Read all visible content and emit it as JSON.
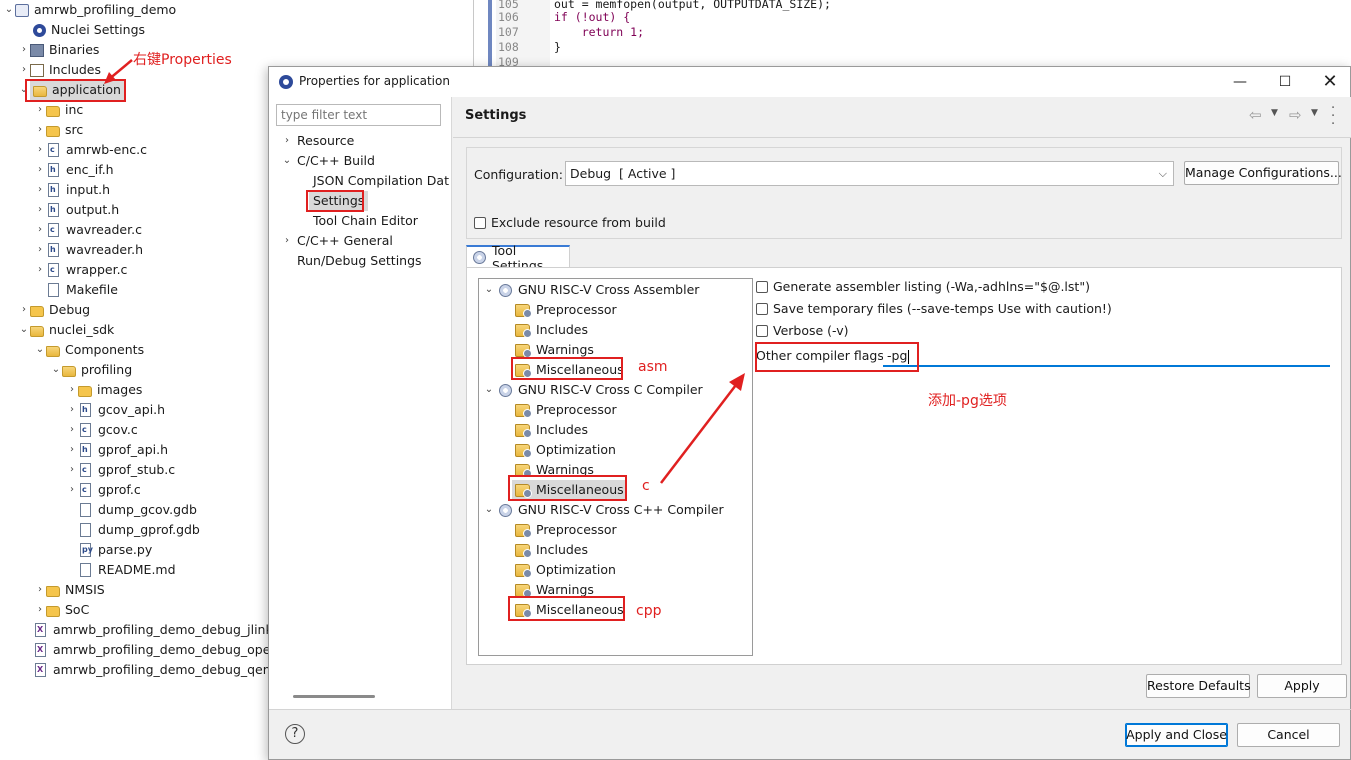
{
  "code": {
    "lines": [
      {
        "num": "105",
        "text": "out = memfopen(output, OUTPUTDATA_SIZE);"
      },
      {
        "num": "106",
        "text": "if (!out) {"
      },
      {
        "num": "107",
        "text": "    return 1;"
      },
      {
        "num": "108",
        "text": "}"
      },
      {
        "num": "109",
        "text": ""
      }
    ]
  },
  "explorer": {
    "project": "amrwb_profiling_demo",
    "nuclei_settings": "Nuclei Settings",
    "binaries": "Binaries",
    "includes": "Includes",
    "application": "application",
    "app_children": [
      "inc",
      "src",
      "amrwb-enc.c",
      "enc_if.h",
      "input.h",
      "output.h",
      "wavreader.c",
      "wavreader.h",
      "wrapper.c",
      "Makefile"
    ],
    "debug": "Debug",
    "nuclei_sdk": "nuclei_sdk",
    "components": "Components",
    "profiling": "profiling",
    "profiling_children": [
      "images",
      "gcov_api.h",
      "gcov.c",
      "gprof_api.h",
      "gprof_stub.c",
      "gprof.c",
      "dump_gcov.gdb",
      "dump_gprof.gdb",
      "parse.py",
      "README.md"
    ],
    "nmsis": "NMSIS",
    "soc": "SoC",
    "launch_files": [
      "amrwb_profiling_demo_debug_jlink.la",
      "amrwb_profiling_demo_debug_openo",
      "amrwb_profiling_demo_debug_qemu"
    ]
  },
  "annotations": {
    "right_click": "右键Properties",
    "asm": "asm",
    "c": "c",
    "cpp": "cpp",
    "add_pg": "添加-pg选项"
  },
  "dialog": {
    "title": "Properties for application",
    "filter_placeholder": "type filter text",
    "nav": {
      "resource": "Resource",
      "build": "C/C++ Build",
      "json": "JSON Compilation Dat",
      "settings": "Settings",
      "toolchain": "Tool Chain Editor",
      "general": "C/C++ General",
      "rundebug": "Run/Debug Settings"
    },
    "page_title": "Settings",
    "configuration_label": "Configuration:",
    "configuration_value": "Debug  [ Active ]",
    "manage_button": "Manage Configurations...",
    "exclude_label": "Exclude resource from build",
    "tool_settings_tab": "Tool Settings",
    "tools": {
      "assembler": "GNU RISC-V Cross Assembler",
      "asm_children": [
        "Preprocessor",
        "Includes",
        "Warnings",
        "Miscellaneous"
      ],
      "c_compiler": "GNU RISC-V Cross C Compiler",
      "c_children": [
        "Preprocessor",
        "Includes",
        "Optimization",
        "Warnings",
        "Miscellaneous"
      ],
      "cpp_compiler": "GNU RISC-V Cross C++ Compiler",
      "cpp_children": [
        "Preprocessor",
        "Includes",
        "Optimization",
        "Warnings",
        "Miscellaneous"
      ]
    },
    "options": {
      "gen_listing": "Generate assembler listing (-Wa,-adhlns=\"$@.lst\")",
      "save_temps": "Save temporary files (--save-temps Use with caution!)",
      "verbose": "Verbose (-v)",
      "other_flags_label": "Other compiler flags",
      "other_flags_value": "-pg"
    },
    "restore_defaults": "Restore Defaults",
    "apply": "Apply",
    "apply_and_close": "Apply and Close",
    "cancel": "Cancel",
    "help": "?"
  },
  "colors": {
    "annotation_red": "#e02020",
    "selection_blue": "#cce8ff",
    "focus_blue": "#0078d7"
  }
}
